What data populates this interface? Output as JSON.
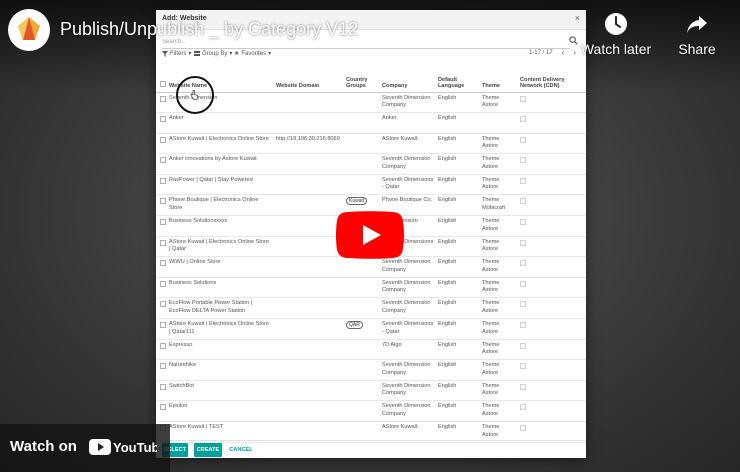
{
  "video": {
    "title": "Publish/Unpublish _ by Category V12",
    "channel_logo_text": "7 | +",
    "watch_later_label": "Watch later",
    "share_label": "Share",
    "watch_on_label": "Watch on",
    "youtube_label": "YouTube"
  },
  "dialog": {
    "title": "Add: Website",
    "close_glyph": "×",
    "search": {
      "value": "",
      "placeholder": "Search..."
    },
    "filters_label": "Filters",
    "group_by_label": "Group By",
    "favorites_label": "Favorites",
    "pager": "1-17 / 17",
    "columns": [
      "Website Name",
      "Website Domain",
      "Country Groups",
      "Company",
      "Default Language",
      "Theme",
      "Content Delivery Network (CDN)"
    ],
    "rows": [
      {
        "name": "Seventh Dimension",
        "domain": "",
        "country_group": "",
        "company": "Seventh Dimension Company",
        "language": "English",
        "theme": "Theme Astore"
      },
      {
        "name": "Anker",
        "domain": "",
        "country_group": "",
        "company": "Anker",
        "language": "English",
        "theme": ""
      },
      {
        "name": "AStore Kuwait | Electronics Online Store",
        "domain": "http://18.196.30.216:8069",
        "country_group": "",
        "company": "AStore Kuwait",
        "language": "English",
        "theme": "Theme Astore"
      },
      {
        "name": "Anker innovations by Astore Kuwait",
        "domain": "",
        "country_group": "",
        "company": "Seventh Dimension Company",
        "language": "English",
        "theme": "Theme Astore"
      },
      {
        "name": "RavPower | Qatar | Stay Powered",
        "domain": "",
        "country_group": "",
        "company": "Seventh Dimensions - Qatar",
        "language": "English",
        "theme": "Theme Astore"
      },
      {
        "name": "Phone Boutique | Electronics Online Store",
        "domain": "",
        "country_group": "Kuwait",
        "company": "Phone Boutique Co.",
        "language": "English",
        "theme": "Theme Mobicraft"
      },
      {
        "name": "Business Solutionxxxxx",
        "domain": "",
        "country_group": "",
        "company": "7th Dimension",
        "language": "English",
        "theme": "Theme Astore"
      },
      {
        "name": "AStore Kuwait | Electronics Online Store | Qatar",
        "domain": "",
        "country_group": "",
        "company": "Seventh Dimensions - Qatar",
        "language": "English",
        "theme": "Theme Astore"
      },
      {
        "name": "WiWU | Online Store",
        "domain": "",
        "country_group": "",
        "company": "Seventh Dimension Company",
        "language": "English",
        "theme": "Theme Astore"
      },
      {
        "name": "Business Solutions",
        "domain": "",
        "country_group": "",
        "company": "Seventh Dimension Company",
        "language": "English",
        "theme": "Theme Astore"
      },
      {
        "name": "EcoFlow Portable Power Station | EcoFlow DELTA Power Station",
        "domain": "",
        "country_group": "",
        "company": "Seventh Dimension Company",
        "language": "English",
        "theme": "Theme Astore"
      },
      {
        "name": "AStore Kuwait | Electronics Online Store | Qatar111",
        "domain": "",
        "country_group": "QAR",
        "company": "Seventh Dimensions - Qatar",
        "language": "English",
        "theme": "Theme Astore"
      },
      {
        "name": "Espresso",
        "domain": "",
        "country_group": "",
        "company": "7D Algo",
        "language": "English",
        "theme": "Theme Astore"
      },
      {
        "name": "Naturehike",
        "domain": "",
        "country_group": "",
        "company": "Seventh Dimension Company",
        "language": "English",
        "theme": "Theme Astore"
      },
      {
        "name": "SwitchBot",
        "domain": "",
        "country_group": "",
        "company": "Seventh Dimension Company",
        "language": "English",
        "theme": "Theme Astore"
      },
      {
        "name": "Epsilon",
        "domain": "",
        "country_group": "",
        "company": "Seventh Dimension Company",
        "language": "English",
        "theme": "Theme Astore"
      },
      {
        "name": "AStore Kuwait | TEST",
        "domain": "",
        "country_group": "",
        "company": "AStore Kuwait",
        "language": "English",
        "theme": "Theme Astore"
      }
    ],
    "footer": {
      "select_label": "SELECT",
      "create_label": "CREATE",
      "cancel_label": "CANCEL"
    },
    "colors": {
      "accent": "#00a09d"
    }
  }
}
